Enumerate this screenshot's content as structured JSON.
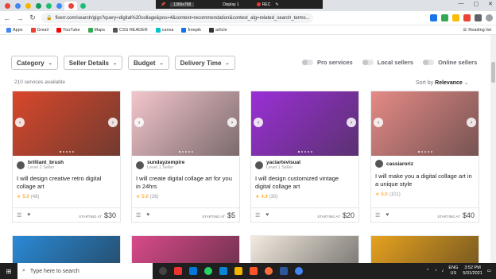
{
  "browser": {
    "url": "fiverr.com/search/gigs?query=digital%20collage&pos=4&context=recommendation&context_alg=related_search_terms...",
    "tab_colors": [
      "#e8453c",
      "#4285f4",
      "#f4b400",
      "#0f9d58",
      "#1dbf73",
      "#4285f4",
      "#e8453c",
      "#1dbf73"
    ],
    "reading_list": "Reading list"
  },
  "recorder": {
    "resolution": "1366x768",
    "display": "Display 1",
    "rec": "REC"
  },
  "bookmarks": [
    {
      "label": "Apps",
      "color": "#4285f4"
    },
    {
      "label": "Gmail",
      "color": "#ea4335"
    },
    {
      "label": "YouTube",
      "color": "#ff0000"
    },
    {
      "label": "Maps",
      "color": "#34a853"
    },
    {
      "label": "CSS READER",
      "color": "#555555"
    },
    {
      "label": "canva",
      "color": "#00c4cc"
    },
    {
      "label": "freepik",
      "color": "#1273eb"
    },
    {
      "label": "article",
      "color": "#333333"
    }
  ],
  "filters": [
    "Category",
    "Seller Details",
    "Budget",
    "Delivery Time"
  ],
  "toggles": [
    "Pro services",
    "Local sellers",
    "Online sellers"
  ],
  "results": {
    "count": "210 services available",
    "sort_label": "Sort by",
    "sort_value": "Relevance"
  },
  "gigs": [
    {
      "seller": "brilliant_brush",
      "level": "Level 2 Seller",
      "title": "I will design creative retro digital collage art",
      "rating": "5.0",
      "reviews": "(48)",
      "starting": "STARTING AT",
      "price": "$30",
      "img": "#d9472b"
    },
    {
      "seller": "sundayzempire",
      "level": "Level 1 Seller",
      "title": "I will create digital collage art for you in 24hrs",
      "rating": "5.0",
      "reviews": "(26)",
      "starting": "STARTING AT",
      "price": "$5",
      "img": "#f3c6cc"
    },
    {
      "seller": "yaciartevisual",
      "level": "Level 1 Seller",
      "title": "I will design customized vintage digital collage art",
      "rating": "4.9",
      "reviews": "(30)",
      "starting": "STARTING AT",
      "price": "$20",
      "img": "#9b2fd6"
    },
    {
      "seller": "cassiaroriz",
      "level": "",
      "title": "I will make you a digital collage art in a unique style",
      "rating": "5.0",
      "reviews": "(101)",
      "starting": "STARTING AT",
      "price": "$40",
      "img": "#e58a86"
    }
  ],
  "row2_colors": [
    "#2a8ad6",
    "#d94a8a",
    "#f3ebe0",
    "#e7a21f"
  ],
  "taskbar": {
    "search": "Type here to search",
    "lang": "ENG",
    "region": "US",
    "time": "3:52 PM",
    "date": "5/31/2021"
  }
}
